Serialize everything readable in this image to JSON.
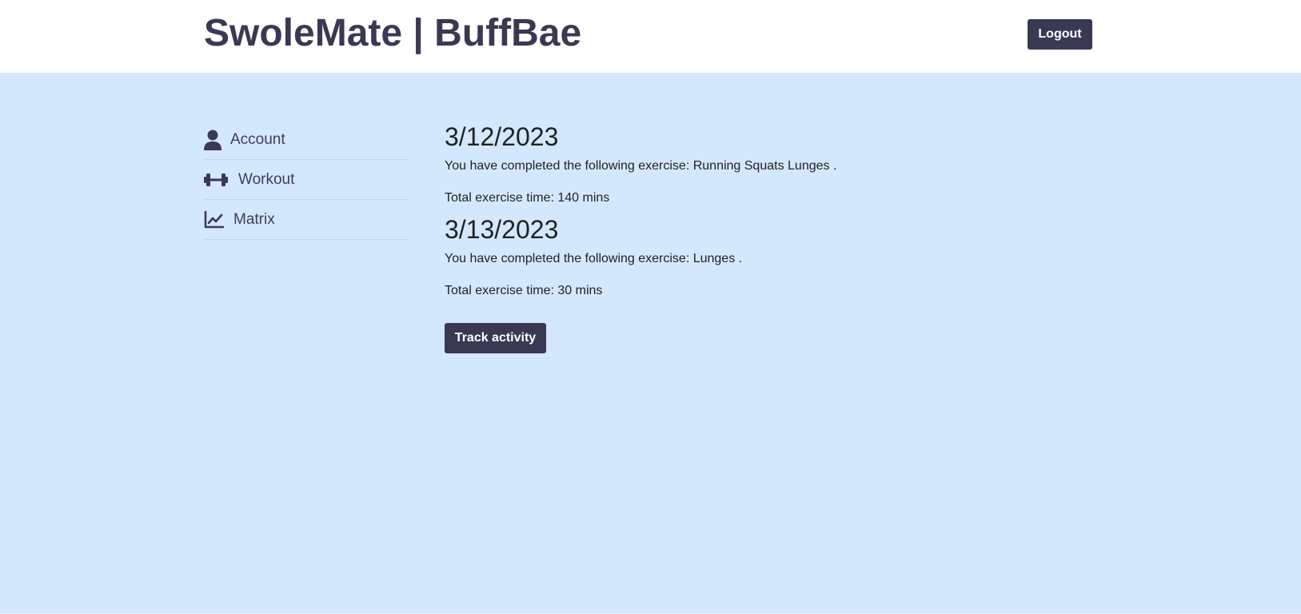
{
  "header": {
    "brand": "SwoleMate | BuffBae",
    "logout_label": "Logout"
  },
  "sidebar": {
    "items": [
      {
        "label": "Account",
        "icon": "user-icon"
      },
      {
        "label": "Workout",
        "icon": "dumbbell-icon"
      },
      {
        "label": "Matrix",
        "icon": "chart-line-icon"
      }
    ]
  },
  "entries": [
    {
      "date": "3/12/2023",
      "exercise_text": "You have completed the following exercise: Running Squats Lunges .",
      "time_text": "Total exercise time: 140 mins"
    },
    {
      "date": "3/13/2023",
      "exercise_text": "You have completed the following exercise: Lunges .",
      "time_text": "Total exercise time: 30 mins"
    }
  ],
  "actions": {
    "track_label": "Track activity"
  },
  "colors": {
    "accent": "#3a3954",
    "background": "#d4e8fd",
    "header_bg": "#ffffff"
  }
}
